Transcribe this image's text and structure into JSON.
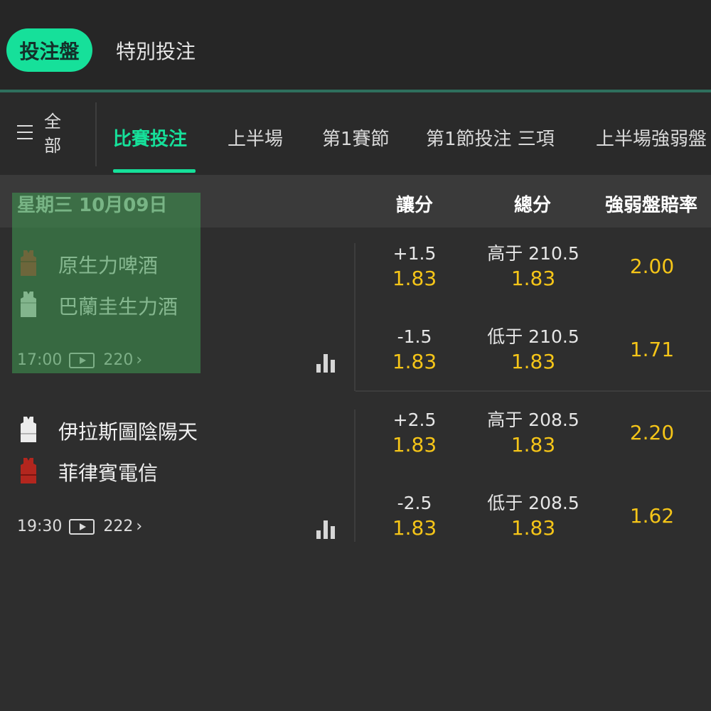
{
  "top_tabs": {
    "active": "投注盤",
    "second": "特別投注"
  },
  "menu": {
    "label": "全部"
  },
  "sub_tabs": [
    "比賽投注",
    "上半場",
    "第1賽節",
    "第1節投注 三項",
    "上半場強弱盤"
  ],
  "header": {
    "date": "星期三 10月09日",
    "col_spread": "讓分",
    "col_total": "總分",
    "col_moneyline": "強弱盤賠率"
  },
  "colors": {
    "accent": "#16e09a",
    "odds": "#f5c518",
    "highlight": "#3d914f"
  },
  "matches": [
    {
      "home": {
        "name": "原生力啤酒",
        "jersey": "red-jersey-icon"
      },
      "away": {
        "name": "巴蘭圭生力酒",
        "jersey": "white-jersey-icon"
      },
      "time": "17:00",
      "markets": "220",
      "rows": [
        {
          "spread_line": "+1.5",
          "spread_odds": "1.83",
          "total_line": "高于 210.5",
          "total_odds": "1.83",
          "moneyline": "2.00"
        },
        {
          "spread_line": "-1.5",
          "spread_odds": "1.83",
          "total_line": "低于 210.5",
          "total_odds": "1.83",
          "moneyline": "1.71"
        }
      ]
    },
    {
      "home": {
        "name": "伊拉斯圖陰陽天",
        "jersey": "white-jersey-icon"
      },
      "away": {
        "name": "菲律賓電信",
        "jersey": "red-jersey-icon"
      },
      "time": "19:30",
      "markets": "222",
      "rows": [
        {
          "spread_line": "+2.5",
          "spread_odds": "1.83",
          "total_line": "高于 208.5",
          "total_odds": "1.83",
          "moneyline": "2.20"
        },
        {
          "spread_line": "-2.5",
          "spread_odds": "1.83",
          "total_line": "低于 208.5",
          "total_odds": "1.83",
          "moneyline": "1.62"
        }
      ]
    }
  ]
}
